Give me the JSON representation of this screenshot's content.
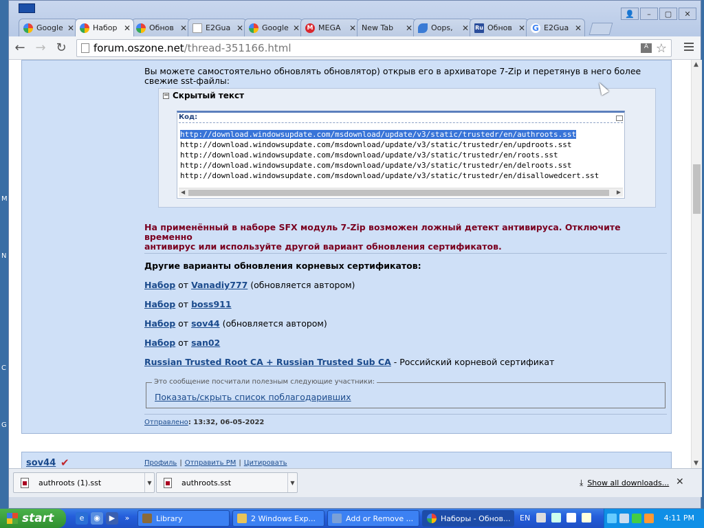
{
  "desktop_strip_letters": [
    "M",
    "N",
    "C",
    "G"
  ],
  "browser": {
    "tabs": [
      {
        "label": "Google",
        "favicon": "chrome-icon",
        "active": false
      },
      {
        "label": "Набор",
        "favicon": "chrome-icon",
        "active": true
      },
      {
        "label": "Обнов",
        "favicon": "chrome-icon",
        "active": false
      },
      {
        "label": "E2Gua",
        "favicon": "doc-icon",
        "active": false
      },
      {
        "label": "Google",
        "favicon": "chrome-icon",
        "active": false
      },
      {
        "label": "MEGA",
        "favicon": "mega-icon",
        "active": false
      },
      {
        "label": "New Tab",
        "favicon": "none",
        "active": false
      },
      {
        "label": "Oops,",
        "favicon": "oops-icon",
        "active": false
      },
      {
        "label": "Обнов",
        "favicon": "ru-icon",
        "active": false
      },
      {
        "label": "E2Gua",
        "favicon": "google-g-icon",
        "active": false
      }
    ],
    "address": {
      "host": "forum.oszone.net",
      "path": "/thread-351166.html"
    },
    "window_controls": {
      "user": "👤",
      "minimize": "–",
      "maximize": "▢",
      "close": "✕"
    }
  },
  "post": {
    "intro_line1": "Вы можете самостоятельно обновлять обновлятор) открыв его в архиваторе 7-Zip и перетянув в него более",
    "intro_line2": "свежие sst-файлы:",
    "hidden_title": "Скрытый текст",
    "code_label": "Код:",
    "code_lines": [
      "http://download.windowsupdate.com/msdownload/update/v3/static/trustedr/en/authroots.sst",
      "http://download.windowsupdate.com/msdownload/update/v3/static/trustedr/en/updroots.sst",
      "http://download.windowsupdate.com/msdownload/update/v3/static/trustedr/en/roots.sst",
      "http://download.windowsupdate.com/msdownload/update/v3/static/trustedr/en/delroots.sst",
      "http://download.windowsupdate.com/msdownload/update/v3/static/trustedr/en/disallowedcert.sst"
    ],
    "warning_line1": "На применённый в наборе SFX модуль 7-Zip возможен ложный детект антивируса. Отключите временно",
    "warning_line2": "антивирус или используйте другой вариант обновления сертификатов.",
    "variants_title": "Другие варианты обновления корневых сертификатов:",
    "variants": [
      {
        "link": "Набор",
        "mid": " от ",
        "author": "Vanadiy777",
        "note": " (обновляется автором)"
      },
      {
        "link": "Набор",
        "mid": " от ",
        "author": "boss911",
        "note": ""
      },
      {
        "link": "Набор",
        "mid": " от ",
        "author": "sov44",
        "note": " (обновляется автором)"
      },
      {
        "link": "Набор",
        "mid": " от ",
        "author": "san02",
        "note": ""
      }
    ],
    "cert_link": "Russian Trusted Root CA + Russian Trusted Sub CA",
    "cert_note": " - Российский корневой сертификат",
    "thanks_legend": "Это сообщение посчитали полезным следующие участники:",
    "thanks_link": "Показать/скрыть список поблагодаривших",
    "posted_label": "Отправлено",
    "posted_time": ": 13:32, 06-05-2022"
  },
  "post2": {
    "author": "sov44",
    "actions": [
      "Профиль",
      "Отправить PM",
      "Цитировать"
    ]
  },
  "downloads": {
    "items": [
      "authroots (1).sst",
      "authroots.sst"
    ],
    "show_all": "Show all downloads...",
    "close": "✕"
  },
  "taskbar": {
    "start": "start",
    "buttons": [
      {
        "label": "Library",
        "active": false
      },
      {
        "label": "2 Windows Exp...",
        "active": false
      },
      {
        "label": "Add or Remove ...",
        "active": false
      },
      {
        "label": "Наборы - Обнов...",
        "active": true
      }
    ],
    "lang": "EN",
    "clock": "4:11 PM"
  }
}
